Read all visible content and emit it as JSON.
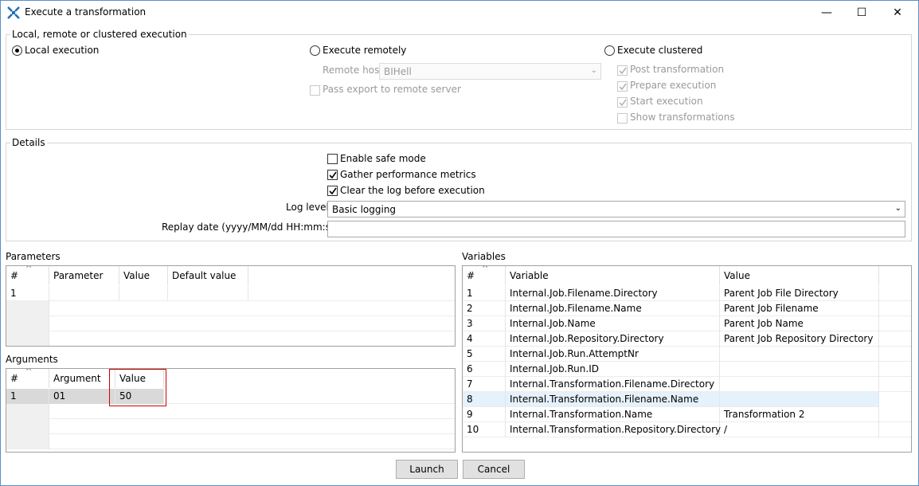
{
  "window": {
    "title": "Execute a transformation",
    "minimize": "—",
    "maximize": "☐",
    "close": "✕"
  },
  "execution": {
    "group_label": "Local, remote or clustered execution",
    "local_label": "Local execution",
    "remote_label": "Execute remotely",
    "remote_host_label": "Remote host",
    "remote_host_value": "BIHell",
    "pass_export_label": "Pass export to remote server",
    "clustered_label": "Execute clustered",
    "post_transformation": "Post transformation",
    "prepare_execution": "Prepare execution",
    "start_execution": "Start execution",
    "show_transformations": "Show transformations",
    "selected": "local"
  },
  "details": {
    "group_label": "Details",
    "safe_mode_label": "Enable safe mode",
    "safe_mode_checked": false,
    "gather_metrics_label": "Gather performance metrics",
    "gather_metrics_checked": true,
    "clear_log_label": "Clear the log before execution",
    "clear_log_checked": true,
    "log_level_label": "Log level",
    "log_level_value": "Basic logging",
    "replay_date_label": "Replay date (yyyy/MM/dd HH:mm:ss)",
    "replay_date_value": ""
  },
  "parameters": {
    "label": "Parameters",
    "columns": [
      "#",
      "Parameter",
      "Value",
      "Default value"
    ],
    "rows": [
      [
        "1",
        "",
        "",
        ""
      ]
    ]
  },
  "arguments": {
    "label": "Arguments",
    "columns": [
      "#",
      "Argument",
      "Value"
    ],
    "rows": [
      [
        "1",
        "01",
        "50"
      ]
    ]
  },
  "variables": {
    "label": "Variables",
    "columns": [
      "#",
      "Variable",
      "Value"
    ],
    "rows": [
      [
        "1",
        "Internal.Job.Filename.Directory",
        "Parent Job File Directory"
      ],
      [
        "2",
        "Internal.Job.Filename.Name",
        "Parent Job Filename"
      ],
      [
        "3",
        "Internal.Job.Name",
        "Parent Job Name"
      ],
      [
        "4",
        "Internal.Job.Repository.Directory",
        "Parent Job Repository Directory"
      ],
      [
        "5",
        "Internal.Job.Run.AttemptNr",
        ""
      ],
      [
        "6",
        "Internal.Job.Run.ID",
        ""
      ],
      [
        "7",
        "Internal.Transformation.Filename.Directory",
        ""
      ],
      [
        "8",
        "Internal.Transformation.Filename.Name",
        ""
      ],
      [
        "9",
        "Internal.Transformation.Name",
        "Transformation 2"
      ],
      [
        "10",
        "Internal.Transformation.Repository.Directory",
        "/"
      ]
    ],
    "selected_row": 8
  },
  "buttons": {
    "launch": "Launch",
    "cancel": "Cancel"
  },
  "colors": {
    "selected_row": "#e5f1fb",
    "highlight_border": "#cc0000"
  }
}
